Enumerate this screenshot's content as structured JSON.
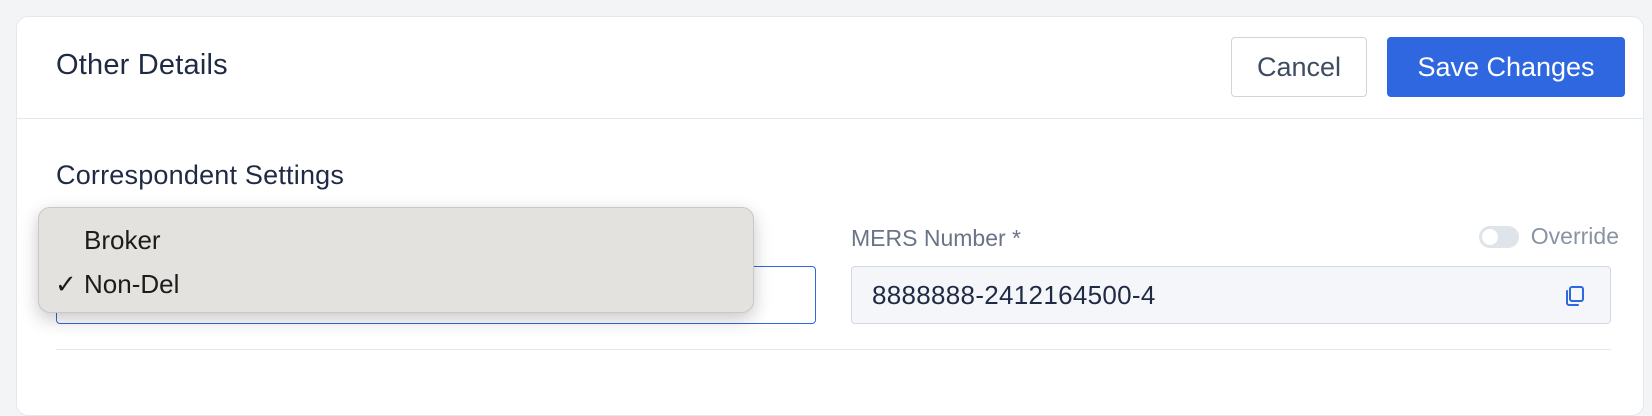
{
  "card": {
    "title": "Other Details",
    "cancel_label": "Cancel",
    "save_label": "Save Changes"
  },
  "section": {
    "title": "Correspondent Settings"
  },
  "channel_select": {
    "options": [
      {
        "label": "Broker",
        "selected": false
      },
      {
        "label": "Non-Del",
        "selected": true
      }
    ],
    "check_glyph": "✓"
  },
  "mers": {
    "label": "MERS Number *",
    "value": "8888888-2412164500-4",
    "override_label": "Override",
    "override_on": false
  },
  "colors": {
    "accent": "#2e67e0",
    "page_bg": "#f3f4f6",
    "menu_bg": "#e3e2df"
  },
  "icons": {
    "copy": "copy-icon",
    "check": "check-icon"
  }
}
